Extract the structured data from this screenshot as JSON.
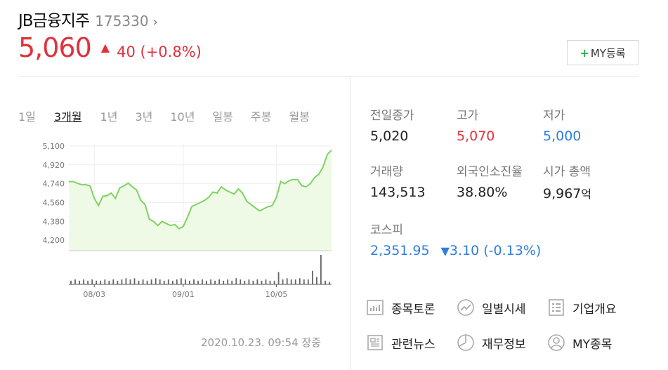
{
  "header": {
    "name": "JB금융지주",
    "code": "175330",
    "chevron": "›"
  },
  "quote": {
    "price": "5,060",
    "direction_icon": "▲",
    "change": "40 (+0.8%)"
  },
  "my_button": {
    "plus": "+",
    "label": "MY등록"
  },
  "periods": [
    {
      "label": "1일",
      "active": false
    },
    {
      "label": "3개월",
      "active": true
    },
    {
      "label": "1년",
      "active": false
    },
    {
      "label": "3년",
      "active": false
    },
    {
      "label": "10년",
      "active": false
    },
    {
      "label": "일봉",
      "active": false
    },
    {
      "label": "주봉",
      "active": false
    },
    {
      "label": "월봉",
      "active": false
    }
  ],
  "chart_data": {
    "type": "area",
    "y_tick_labels": [
      "5,100",
      "4,920",
      "4,740",
      "4,560",
      "4,380",
      "4,200"
    ],
    "ylim": [
      4100,
      5120
    ],
    "x_tick_labels": [
      "08/03",
      "09/01",
      "10/05"
    ],
    "x_tick_index": [
      6,
      27,
      49
    ],
    "line_color": "#7ed35f",
    "fill_color": "#eefae6",
    "values": [
      4760,
      4760,
      4745,
      4730,
      4730,
      4720,
      4600,
      4530,
      4620,
      4625,
      4650,
      4600,
      4700,
      4720,
      4745,
      4710,
      4680,
      4580,
      4540,
      4400,
      4380,
      4340,
      4380,
      4360,
      4340,
      4350,
      4310,
      4330,
      4420,
      4520,
      4540,
      4560,
      4580,
      4610,
      4660,
      4650,
      4710,
      4680,
      4660,
      4640,
      4690,
      4650,
      4570,
      4540,
      4510,
      4480,
      4500,
      4520,
      4530,
      4610,
      4760,
      4740,
      4770,
      4780,
      4780,
      4720,
      4710,
      4740,
      4800,
      4830,
      4900,
      5020,
      5060
    ],
    "volume": [
      3,
      4,
      3,
      4,
      3,
      4,
      3,
      3,
      4,
      3,
      4,
      3,
      4,
      5,
      4,
      5,
      3,
      4,
      3,
      4,
      5,
      4,
      3,
      4,
      3,
      4,
      5,
      4,
      3,
      4,
      3,
      4,
      3,
      4,
      3,
      4,
      3,
      4,
      3,
      5,
      4,
      3,
      4,
      3,
      4,
      3,
      4,
      3,
      3,
      10,
      4,
      5,
      4,
      4,
      5,
      4,
      4,
      11,
      6,
      24,
      3,
      2
    ]
  },
  "timestamp": "2020.10.23. 09:54 장중",
  "stats": {
    "prev_close": {
      "label": "전일종가",
      "value": "5,020"
    },
    "high": {
      "label": "고가",
      "value": "5,070"
    },
    "low": {
      "label": "저가",
      "value": "5,000"
    },
    "volume": {
      "label": "거래량",
      "value": "143,513"
    },
    "foreign": {
      "label": "외국인소진율",
      "value": "38.80%"
    },
    "market_cap": {
      "label": "시가 총액",
      "value": "9,967",
      "unit": "억"
    },
    "kospi": {
      "label": "코스피",
      "value": "2,351.95",
      "icon": "▼",
      "change": "3.10 (-0.13%)"
    }
  },
  "links": [
    {
      "label": "종목토론",
      "icon": "chart-board-icon"
    },
    {
      "label": "일별시세",
      "icon": "trend-circle-icon"
    },
    {
      "label": "기업개요",
      "icon": "list-doc-icon"
    },
    {
      "label": "관련뉴스",
      "icon": "newspaper-icon"
    },
    {
      "label": "재무정보",
      "icon": "pie-chart-icon"
    },
    {
      "label": "MY종목",
      "icon": "user-circle-icon"
    }
  ]
}
